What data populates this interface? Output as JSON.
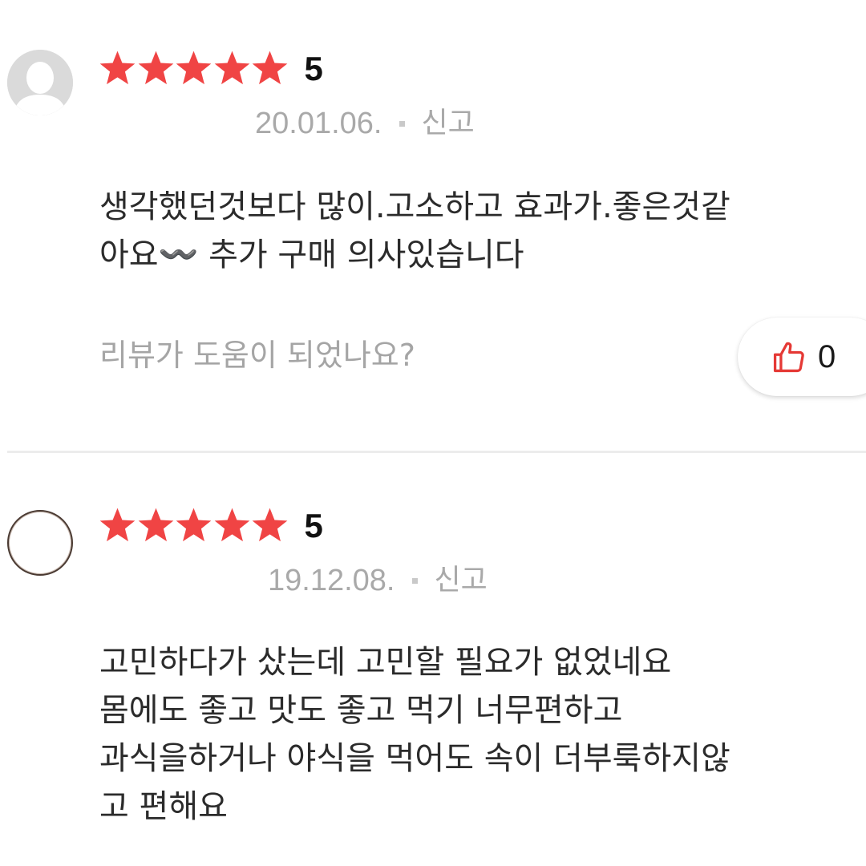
{
  "reviews": [
    {
      "rating": "5",
      "stars_filled": 5,
      "date": "20.01.06.",
      "report_label": "신고",
      "content_lines": [
        "생각했던것보다 많이.고소하고 효과가.좋은것같",
        "아요〰️ 추가 구매 의사있습니다"
      ],
      "helpful_question": "리뷰가 도움이 되었나요?",
      "like_count": "0",
      "avatar": "default-user-avatar"
    },
    {
      "rating": "5",
      "stars_filled": 5,
      "date": "19.12.08.",
      "report_label": "신고",
      "content_lines": [
        "고민하다가 샀는데 고민할 필요가 없었네요",
        "몸에도 좋고 맛도 좋고 먹기 너무편하고",
        "과식을하거나 야식을 먹어도 속이 더부룩하지않",
        "고 편해요"
      ],
      "avatar": "blank-circle-avatar"
    }
  ],
  "colors": {
    "star": "#f04444",
    "meta_text": "#a9a9a9",
    "body_text": "#2b2b2b",
    "like_icon": "#e53935",
    "divider": "#ececec"
  }
}
